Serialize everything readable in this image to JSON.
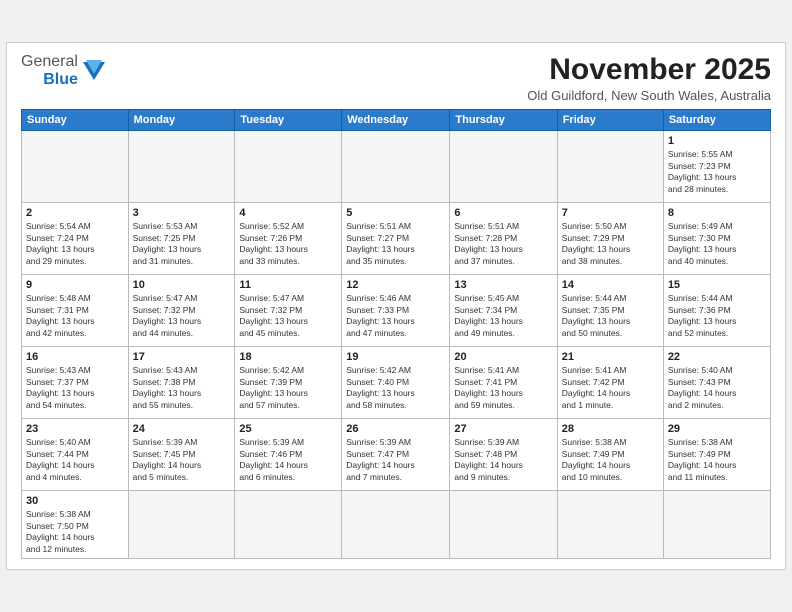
{
  "header": {
    "logo_general": "General",
    "logo_blue": "Blue",
    "month_title": "November 2025",
    "location": "Old Guildford, New South Wales, Australia"
  },
  "weekdays": [
    "Sunday",
    "Monday",
    "Tuesday",
    "Wednesday",
    "Thursday",
    "Friday",
    "Saturday"
  ],
  "weeks": [
    [
      {
        "day": "",
        "info": ""
      },
      {
        "day": "",
        "info": ""
      },
      {
        "day": "",
        "info": ""
      },
      {
        "day": "",
        "info": ""
      },
      {
        "day": "",
        "info": ""
      },
      {
        "day": "",
        "info": ""
      },
      {
        "day": "1",
        "info": "Sunrise: 5:55 AM\nSunset: 7:23 PM\nDaylight: 13 hours\nand 28 minutes."
      }
    ],
    [
      {
        "day": "2",
        "info": "Sunrise: 5:54 AM\nSunset: 7:24 PM\nDaylight: 13 hours\nand 29 minutes."
      },
      {
        "day": "3",
        "info": "Sunrise: 5:53 AM\nSunset: 7:25 PM\nDaylight: 13 hours\nand 31 minutes."
      },
      {
        "day": "4",
        "info": "Sunrise: 5:52 AM\nSunset: 7:26 PM\nDaylight: 13 hours\nand 33 minutes."
      },
      {
        "day": "5",
        "info": "Sunrise: 5:51 AM\nSunset: 7:27 PM\nDaylight: 13 hours\nand 35 minutes."
      },
      {
        "day": "6",
        "info": "Sunrise: 5:51 AM\nSunset: 7:28 PM\nDaylight: 13 hours\nand 37 minutes."
      },
      {
        "day": "7",
        "info": "Sunrise: 5:50 AM\nSunset: 7:29 PM\nDaylight: 13 hours\nand 38 minutes."
      },
      {
        "day": "8",
        "info": "Sunrise: 5:49 AM\nSunset: 7:30 PM\nDaylight: 13 hours\nand 40 minutes."
      }
    ],
    [
      {
        "day": "9",
        "info": "Sunrise: 5:48 AM\nSunset: 7:31 PM\nDaylight: 13 hours\nand 42 minutes."
      },
      {
        "day": "10",
        "info": "Sunrise: 5:47 AM\nSunset: 7:32 PM\nDaylight: 13 hours\nand 44 minutes."
      },
      {
        "day": "11",
        "info": "Sunrise: 5:47 AM\nSunset: 7:32 PM\nDaylight: 13 hours\nand 45 minutes."
      },
      {
        "day": "12",
        "info": "Sunrise: 5:46 AM\nSunset: 7:33 PM\nDaylight: 13 hours\nand 47 minutes."
      },
      {
        "day": "13",
        "info": "Sunrise: 5:45 AM\nSunset: 7:34 PM\nDaylight: 13 hours\nand 49 minutes."
      },
      {
        "day": "14",
        "info": "Sunrise: 5:44 AM\nSunset: 7:35 PM\nDaylight: 13 hours\nand 50 minutes."
      },
      {
        "day": "15",
        "info": "Sunrise: 5:44 AM\nSunset: 7:36 PM\nDaylight: 13 hours\nand 52 minutes."
      }
    ],
    [
      {
        "day": "16",
        "info": "Sunrise: 5:43 AM\nSunset: 7:37 PM\nDaylight: 13 hours\nand 54 minutes."
      },
      {
        "day": "17",
        "info": "Sunrise: 5:43 AM\nSunset: 7:38 PM\nDaylight: 13 hours\nand 55 minutes."
      },
      {
        "day": "18",
        "info": "Sunrise: 5:42 AM\nSunset: 7:39 PM\nDaylight: 13 hours\nand 57 minutes."
      },
      {
        "day": "19",
        "info": "Sunrise: 5:42 AM\nSunset: 7:40 PM\nDaylight: 13 hours\nand 58 minutes."
      },
      {
        "day": "20",
        "info": "Sunrise: 5:41 AM\nSunset: 7:41 PM\nDaylight: 13 hours\nand 59 minutes."
      },
      {
        "day": "21",
        "info": "Sunrise: 5:41 AM\nSunset: 7:42 PM\nDaylight: 14 hours\nand 1 minute."
      },
      {
        "day": "22",
        "info": "Sunrise: 5:40 AM\nSunset: 7:43 PM\nDaylight: 14 hours\nand 2 minutes."
      }
    ],
    [
      {
        "day": "23",
        "info": "Sunrise: 5:40 AM\nSunset: 7:44 PM\nDaylight: 14 hours\nand 4 minutes."
      },
      {
        "day": "24",
        "info": "Sunrise: 5:39 AM\nSunset: 7:45 PM\nDaylight: 14 hours\nand 5 minutes."
      },
      {
        "day": "25",
        "info": "Sunrise: 5:39 AM\nSunset: 7:46 PM\nDaylight: 14 hours\nand 6 minutes."
      },
      {
        "day": "26",
        "info": "Sunrise: 5:39 AM\nSunset: 7:47 PM\nDaylight: 14 hours\nand 7 minutes."
      },
      {
        "day": "27",
        "info": "Sunrise: 5:39 AM\nSunset: 7:48 PM\nDaylight: 14 hours\nand 9 minutes."
      },
      {
        "day": "28",
        "info": "Sunrise: 5:38 AM\nSunset: 7:49 PM\nDaylight: 14 hours\nand 10 minutes."
      },
      {
        "day": "29",
        "info": "Sunrise: 5:38 AM\nSunset: 7:49 PM\nDaylight: 14 hours\nand 11 minutes."
      }
    ],
    [
      {
        "day": "30",
        "info": "Sunrise: 5:38 AM\nSunset: 7:50 PM\nDaylight: 14 hours\nand 12 minutes."
      },
      {
        "day": "",
        "info": ""
      },
      {
        "day": "",
        "info": ""
      },
      {
        "day": "",
        "info": ""
      },
      {
        "day": "",
        "info": ""
      },
      {
        "day": "",
        "info": ""
      },
      {
        "day": "",
        "info": ""
      }
    ]
  ]
}
